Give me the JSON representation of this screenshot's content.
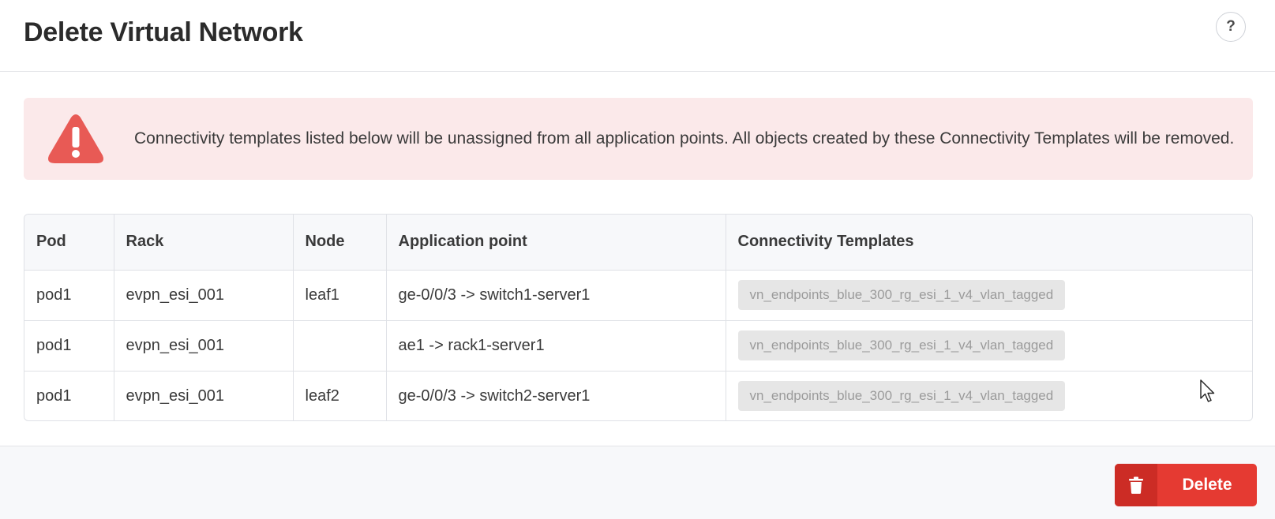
{
  "header": {
    "title": "Delete Virtual Network",
    "help_label": "?"
  },
  "alert": {
    "icon": "warning-triangle-icon",
    "color": "#e85a55",
    "message": "Connectivity templates listed below will be unassigned from all application points. All objects created by these Connectivity Templates will be removed."
  },
  "table": {
    "columns": [
      "Pod",
      "Rack",
      "Node",
      "Application point",
      "Connectivity Templates"
    ],
    "rows": [
      {
        "pod": "pod1",
        "rack": "evpn_esi_001",
        "node": "leaf1",
        "application_point": "ge-0/0/3 -> switch1-server1",
        "template": "vn_endpoints_blue_300_rg_esi_1_v4_vlan_tagged"
      },
      {
        "pod": "pod1",
        "rack": "evpn_esi_001",
        "node": "",
        "application_point": "ae1 -> rack1-server1",
        "template": "vn_endpoints_blue_300_rg_esi_1_v4_vlan_tagged"
      },
      {
        "pod": "pod1",
        "rack": "evpn_esi_001",
        "node": "leaf2",
        "application_point": "ge-0/0/3 -> switch2-server1",
        "template": "vn_endpoints_blue_300_rg_esi_1_v4_vlan_tagged"
      }
    ]
  },
  "footer": {
    "delete_label": "Delete",
    "delete_icon": "trash-icon",
    "delete_color": "#e53a32"
  }
}
